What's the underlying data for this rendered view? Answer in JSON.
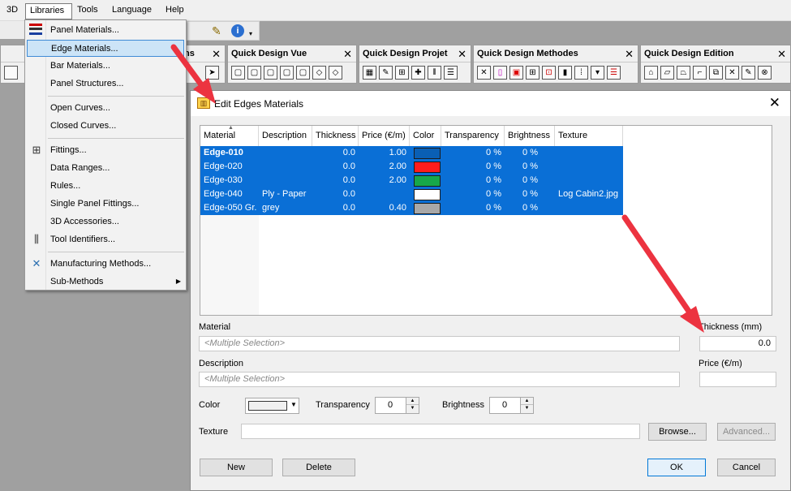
{
  "menubar": {
    "items": [
      "3D",
      "Libraries",
      "Tools",
      "Language",
      "Help"
    ]
  },
  "toolbars": [
    {
      "title": "Quick Design Vue"
    },
    {
      "title": "Quick Design Projet"
    },
    {
      "title": "Quick Design Methodes"
    },
    {
      "title": "Quick Design Edition"
    }
  ],
  "toolbar_partial_label": "ns",
  "libraries_menu": {
    "items": [
      "Panel Materials...",
      "Edge Materials...",
      "Bar Materials...",
      "Panel Structures...",
      "Open Curves...",
      "Closed Curves...",
      "Fittings...",
      "Data Ranges...",
      "Rules...",
      "Single Panel Fittings...",
      "3D Accessories...",
      "Tool Identifiers...",
      "Manufacturing Methods...",
      "Sub-Methods"
    ],
    "highlighted": "Edge Materials...",
    "submenu_arrow": "▶"
  },
  "dialog": {
    "title": "Edit Edges Materials",
    "close_glyph": "✕",
    "columns": [
      "Material",
      "Description",
      "Thickness",
      "Price (€/m)",
      "Color",
      "Transparency",
      "Brightness",
      "Texture"
    ],
    "rows": [
      {
        "material": "Edge-010",
        "description": "",
        "thickness": "0.0",
        "price": "1.00",
        "color": "#0a5fb4",
        "transparency": "0 %",
        "brightness": "0 %",
        "texture": ""
      },
      {
        "material": "Edge-020",
        "description": "",
        "thickness": "0.0",
        "price": "2.00",
        "color": "#ff1c1c",
        "transparency": "0 %",
        "brightness": "0 %",
        "texture": ""
      },
      {
        "material": "Edge-030",
        "description": "",
        "thickness": "0.0",
        "price": "2.00",
        "color": "#17a84a",
        "transparency": "0 %",
        "brightness": "0 %",
        "texture": ""
      },
      {
        "material": "Edge-040",
        "description": "Ply - Paper",
        "thickness": "0.0",
        "price": "",
        "color": "#ffffff",
        "transparency": "0 %",
        "brightness": "0 %",
        "texture": "Log Cabin2.jpg"
      },
      {
        "material": "Edge-050 Gr.",
        "description": "grey",
        "thickness": "0.0",
        "price": "0.40",
        "color": "#a8a8a8",
        "transparency": "0 %",
        "brightness": "0 %",
        "texture": ""
      }
    ],
    "form": {
      "material_label": "Material",
      "material_value": "<Multiple Selection>",
      "description_label": "Description",
      "description_value": "<Multiple Selection>",
      "thickness_label": "Thickness (mm)",
      "thickness_value": "0.0",
      "price_label": "Price (€/m)",
      "price_value": "",
      "color_label": "Color",
      "transparency_label": "Transparency",
      "transparency_value": "0",
      "brightness_label": "Brightness",
      "brightness_value": "0",
      "texture_label": "Texture",
      "texture_value": "",
      "browse_button": "Browse...",
      "advanced_button": "Advanced..."
    },
    "buttons": {
      "new": "New",
      "delete": "Delete",
      "ok": "OK",
      "cancel": "Cancel"
    }
  },
  "annotation_color": "#ec3340"
}
